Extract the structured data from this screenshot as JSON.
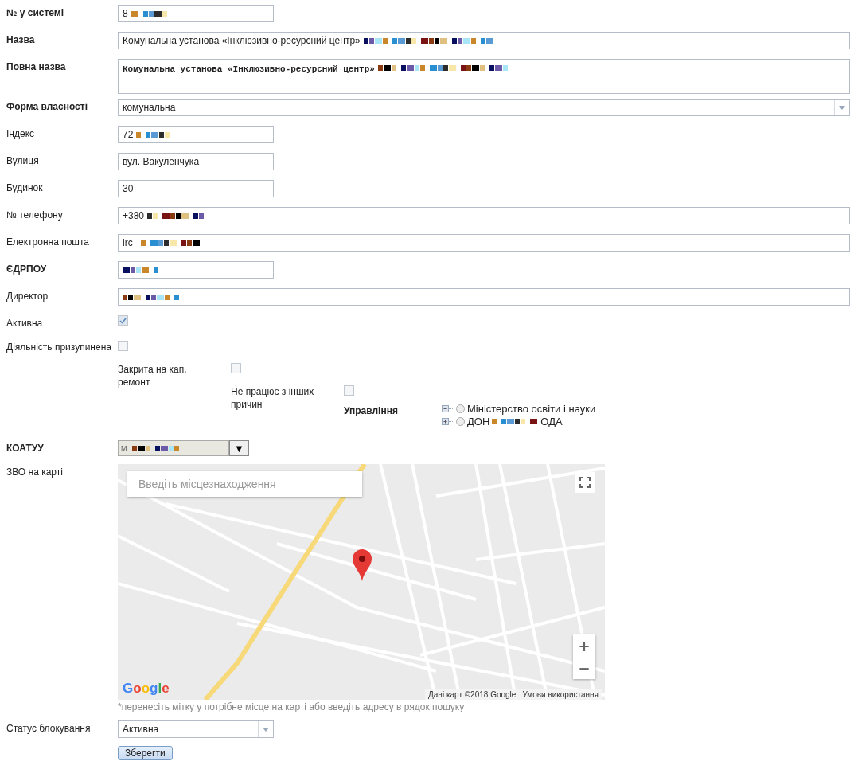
{
  "fields": [
    {
      "kind": "short_text",
      "label": "№ у системі",
      "required": true,
      "value": "8",
      "redacted": true
    },
    {
      "kind": "text",
      "label": "Назва",
      "required": true,
      "value": "Комунальна установа «Інклюзивно-ресурсний центр»",
      "redacted": true
    },
    {
      "kind": "textarea",
      "label": "Повна назва",
      "required": true,
      "value": "Комунальна установа «Інклюзивно-ресурсний центр»",
      "redacted": true
    },
    {
      "kind": "select",
      "label": "Форма власності",
      "required": true,
      "value": "комунальна",
      "redacted": false
    },
    {
      "kind": "short_text",
      "label": "Індекс",
      "required": false,
      "value": "72",
      "redacted": true
    },
    {
      "kind": "short_text",
      "label": "Вулиця",
      "required": false,
      "value": "вул. Вакуленчука",
      "redacted": false
    },
    {
      "kind": "short_text",
      "label": "Будинок",
      "required": false,
      "value": "30",
      "redacted": false
    },
    {
      "kind": "text",
      "label": "№ телефону",
      "required": false,
      "value": "+380",
      "redacted": true
    },
    {
      "kind": "text",
      "label": "Електронна пошта",
      "required": false,
      "value": "irc_",
      "redacted": true
    },
    {
      "kind": "short_text",
      "label": "ЄДРПОУ",
      "required": true,
      "redacted": true
    },
    {
      "kind": "text",
      "label": "Директор",
      "required": false,
      "redacted": true
    },
    {
      "kind": "checkbox",
      "label": "Активна",
      "required": false,
      "checked": true,
      "disabled": true
    }
  ],
  "suspended": {
    "label": "Діяльність призупинена",
    "checked": false,
    "repair": {
      "label": "Закрита на кап. ремонт",
      "checked": false
    },
    "other": {
      "label": "Не працює з інших причин",
      "checked": false
    }
  },
  "management": {
    "label": "Управління",
    "required": true,
    "items": [
      {
        "label": "Міністерство освіти і науки",
        "redacted": false,
        "expanded": true,
        "selected": false
      },
      {
        "label": "ДОН",
        "label_end": "ОДА",
        "redacted": true,
        "expanded": false,
        "selected": false
      }
    ]
  },
  "koatuu": {
    "label": "КОАТУУ",
    "required": true,
    "value": "М",
    "redacted": true,
    "button": "▼"
  },
  "map": {
    "label": "ЗВО на карті",
    "search_placeholder": "Введіть місцезнаходження",
    "logo": "Google",
    "attribution": "Дані карт ©2018 Google",
    "terms": "Умови використання",
    "zoom_in": "+",
    "zoom_out": "−",
    "hint": "*перенесіть мітку у потрібне місце на карті або введіть адресу в рядок пошуку"
  },
  "block_status": {
    "label": "Статус блокування",
    "value": "Активна"
  },
  "save_button": "Зберегти"
}
